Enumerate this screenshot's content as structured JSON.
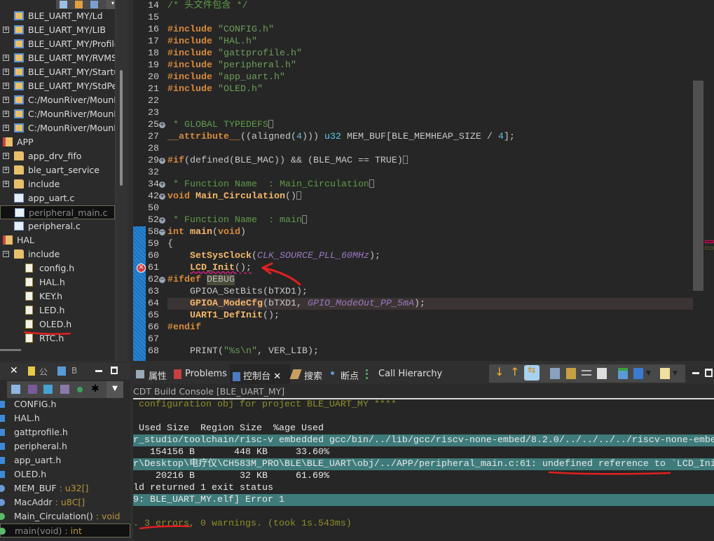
{
  "project_tree": {
    "items": [
      {
        "label": "BLE_UART_MY/Ld",
        "icon": "project-folder-icon",
        "expand": ""
      },
      {
        "label": "BLE_UART_MY/LIB",
        "icon": "project-folder-icon",
        "expand": "+"
      },
      {
        "label": "BLE_UART_MY/Profile",
        "icon": "project-folder-icon",
        "expand": ""
      },
      {
        "label": "BLE_UART_MY/RVMSI",
        "icon": "project-folder-icon",
        "expand": "+"
      },
      {
        "label": "BLE_UART_MY/Startup",
        "icon": "project-folder-icon",
        "expand": "+"
      },
      {
        "label": "BLE_UART_MY/StdPer",
        "icon": "project-folder-icon",
        "expand": "+"
      },
      {
        "label": "C:/MounRiver/MounR",
        "icon": "include-folder-icon",
        "expand": "+"
      },
      {
        "label": "C:/MounRiver/MounR",
        "icon": "include-folder-icon",
        "expand": "+"
      },
      {
        "label": "C:/MounRiver/MounR",
        "icon": "include-folder-icon",
        "expand": "+"
      },
      {
        "label": "APP",
        "icon": "source-folder-error-icon",
        "expand": "",
        "level": 0
      },
      {
        "label": "app_drv_fifo",
        "icon": "folder-icon",
        "expand": "+"
      },
      {
        "label": "ble_uart_service",
        "icon": "folder-icon",
        "expand": "+"
      },
      {
        "label": "include",
        "icon": "folder-icon",
        "expand": "+"
      },
      {
        "label": "app_uart.c",
        "icon": "c-file-icon",
        "expand": ""
      },
      {
        "label": "peripheral_main.c",
        "icon": "c-file-error-icon",
        "expand": "",
        "selected": true
      },
      {
        "label": "peripheral.c",
        "icon": "c-file-icon",
        "expand": ""
      },
      {
        "label": "HAL",
        "icon": "source-folder-icon",
        "expand": "",
        "level": 0
      },
      {
        "label": "include",
        "icon": "folder-icon",
        "expand": "−"
      },
      {
        "label": "config.h",
        "icon": "h-file-icon",
        "expand": "",
        "level": 2
      },
      {
        "label": "HAL.h",
        "icon": "h-file-icon",
        "expand": "",
        "level": 2
      },
      {
        "label": "KEY.h",
        "icon": "h-file-icon",
        "expand": "",
        "level": 2
      },
      {
        "label": "LED.h",
        "icon": "h-file-icon",
        "expand": "",
        "level": 2
      },
      {
        "label": "OLED.h",
        "icon": "h-file-icon",
        "expand": "",
        "level": 2
      },
      {
        "label": "RTC.h",
        "icon": "h-file-icon",
        "expand": "",
        "level": 2
      }
    ]
  },
  "editor": {
    "lines": [
      {
        "n": "14",
        "html": "<span class='cm'>/* 头文件包含 */</span>"
      },
      {
        "n": "15",
        "html": ""
      },
      {
        "n": "16",
        "html": "<span class='kw'>#include</span> <span class='str'>\"CONFIG.h\"</span>"
      },
      {
        "n": "17",
        "html": "<span class='kw'>#include</span> <span class='str'>\"HAL.h\"</span>"
      },
      {
        "n": "18",
        "html": "<span class='kw'>#include</span> <span class='str'>\"gattprofile.h\"</span>"
      },
      {
        "n": "19",
        "html": "<span class='kw'>#include</span> <span class='str'>\"peripheral.h\"</span>"
      },
      {
        "n": "20",
        "html": "<span class='kw'>#include</span> <span class='str'>\"app_uart.h\"</span>"
      },
      {
        "n": "21",
        "html": "<span class='kw'>#include</span> <span class='str'>\"OLED.h\"</span>"
      },
      {
        "n": "22",
        "html": ""
      },
      {
        "n": "23",
        "html": ""
      },
      {
        "n": "25",
        "fold": "+",
        "html": "<span class='cm'> * GLOBAL TYPEDEFS</span><span class='box'></span>"
      },
      {
        "n": "27",
        "html": "<span class='kw'>__attribute__</span><span class='pl'>((aligned(</span><span class='num2'>4</span><span class='pl'>))) </span><span class='ty'>u32</span><span class='pl'> MEM_BUF[BLE_MEMHEAP_SIZE / </span><span class='num2'>4</span><span class='pl'>];</span>"
      },
      {
        "n": "28",
        "html": ""
      },
      {
        "n": "29",
        "fold": "+",
        "html": "<span class='kw'>#if</span><span class='pl'>(defined(BLE_MAC)) &amp;&amp; (BLE_MAC == TRUE)</span><span class='box'></span>"
      },
      {
        "n": "32",
        "html": ""
      },
      {
        "n": "34",
        "fold": "+",
        "html": "<span class='cm'> * Function Name  : Main_Circulation</span><span class='box'></span>"
      },
      {
        "n": "42",
        "fold": "+",
        "html": "<span class='kw'>void</span> <span class='fn'>Main_Circulation</span><span class='pl'>()</span><span class='box'></span>"
      },
      {
        "n": "50",
        "html": ""
      },
      {
        "n": "52",
        "fold": "+",
        "html": "<span class='cm'> * Function Name  : main</span><span class='box'></span>"
      },
      {
        "n": "58",
        "fold": "−",
        "html": "<span class='kw'>int</span> <span class='fn'>main</span><span class='pl'>(</span><span class='kw'>void</span><span class='pl'>)</span>"
      },
      {
        "n": "59",
        "html": "<span class='pl'>{</span>"
      },
      {
        "n": "60",
        "html": "    <span class='fn'>SetSysClock</span><span class='pl'>(</span><span class='mac'>CLK_SOURCE_PLL_60MHz</span><span class='pl'>);</span>"
      },
      {
        "n": "61",
        "error": true,
        "html": "    <span class='fn squig'>LCD_Init</span><span class='pl squig'>();</span>"
      },
      {
        "n": "62",
        "fold": "−",
        "html": "<span class='kw'>#ifdef</span> <span class='dbg'>DEBUG</span>"
      },
      {
        "n": "63",
        "html": "    <span class='pl'>GPIOA_SetBits(bTXD1);</span>"
      },
      {
        "n": "64",
        "highlight": true,
        "html": "    <span class='fn'>GPIOA_ModeCfg</span><span class='pl'>(bTXD1, </span><span class='mac'>GPIO_ModeOut_PP_5mA</span><span class='pl'>);</span>"
      },
      {
        "n": "65",
        "html": "    <span class='fn'>UART1_DefInit</span><span class='pl'>();</span>"
      },
      {
        "n": "66",
        "html": "<span class='kw'>#endif</span>"
      },
      {
        "n": "67",
        "html": ""
      },
      {
        "n": "68",
        "html": "    <span class='pl'>PRINT(</span><span class='str'>\"%s\\n\"</span><span class='pl'>, VER_LIB);</span>"
      }
    ]
  },
  "outline": {
    "tabs": [
      "公",
      "B"
    ],
    "items": [
      {
        "name": "CONFIG.h",
        "type": "",
        "icon": "include-icon"
      },
      {
        "name": "HAL.h",
        "type": "",
        "icon": "include-icon"
      },
      {
        "name": "gattprofile.h",
        "type": "",
        "icon": "include-icon"
      },
      {
        "name": "peripheral.h",
        "type": "",
        "icon": "include-icon"
      },
      {
        "name": "app_uart.h",
        "type": "",
        "icon": "include-icon"
      },
      {
        "name": "OLED.h",
        "type": "",
        "icon": "include-icon"
      },
      {
        "name": "MEM_BUF",
        "type": " : u32[]",
        "icon": "variable-icon"
      },
      {
        "name": "MacAddr",
        "type": " : u8C[]",
        "icon": "variable-icon"
      },
      {
        "name": "Main_Circulation()",
        "type": " : void",
        "icon": "function-icon"
      },
      {
        "name": "main(void)",
        "type": " : int",
        "icon": "function-icon",
        "selected": true
      }
    ]
  },
  "console": {
    "tabs": [
      "属性",
      "Problems",
      "控制台",
      "搜索",
      "断点",
      "Call Hierarchy"
    ],
    "title": "CDT Build Console [BLE_UART_MY]",
    "lines": [
      {
        "text": " configuration obj for project BLE_UART_MY ****",
        "style": "olive"
      },
      {
        "text": "",
        "style": ""
      },
      {
        "text": " Used Size  Region Size  %age Used",
        "style": ""
      },
      {
        "text": "r_studio/toolchain/risc-v embedded gcc/bin/../lib/gcc/riscv-none-embed/8.2.0/../../../../riscv-none-embed",
        "style": "teal"
      },
      {
        "text": "   154156 B       448 KB     33.60%",
        "style": ""
      },
      {
        "text": "r\\Desktop\\电疗仪\\CH583M_PRO\\BLE\\BLE_UART\\obj/../APP/peripheral_main.c:61: undefined reference to `LCD_Init'",
        "style": "teal"
      },
      {
        "text": "    20216 B        32 KB     61.69%",
        "style": ""
      },
      {
        "text": "ld returned 1 exit status",
        "style": ""
      },
      {
        "text": "9: BLE_UART_MY.elf] Error 1",
        "style": "teal"
      },
      {
        "text": "",
        "style": ""
      },
      {
        "text": ". 3 errors, 0 warnings. (took 1s.543ms)",
        "style": "olive"
      }
    ]
  },
  "colors": {
    "editor_bg": "#262626",
    "teal_highlight": "#3f7b7b",
    "keyword": "#d78a3c",
    "string": "#6f9d5c",
    "annotation": "#e02020"
  }
}
